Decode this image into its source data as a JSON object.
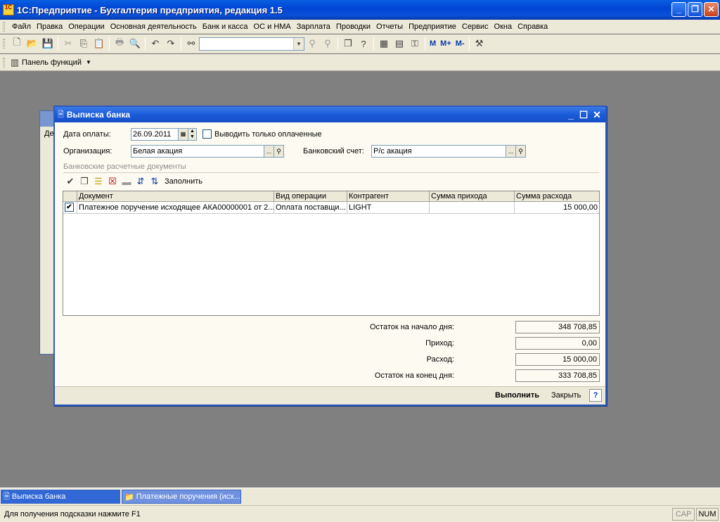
{
  "app": {
    "title": "1С:Предприятие - Бухгалтерия предприятия, редакция 1.5",
    "icon_text": "1C"
  },
  "menu": [
    "Файл",
    "Правка",
    "Операции",
    "Основная деятельность",
    "Банк и касса",
    "ОС и НМА",
    "Зарплата",
    "Проводки",
    "Отчеты",
    "Предприятие",
    "Сервис",
    "Окна",
    "Справка"
  ],
  "toolbar": {
    "m_label": "М",
    "m_plus_label": "М+",
    "m_minus_label": "М-"
  },
  "panel": {
    "label": "Панель функций"
  },
  "dialog": {
    "title": "Выписка банка",
    "date_label": "Дата оплаты:",
    "date_value": "26.09.2011",
    "only_paid_label": "Выводить только оплаченные",
    "only_paid_checked": false,
    "org_label": "Организация:",
    "org_value": "Белая акация",
    "bank_label": "Банковский счет:",
    "bank_value": "Р/с акация",
    "select_btn": "...",
    "search_btn": "🔍",
    "section_title": "Банковские расчетные документы",
    "fill_label": "Заполнить",
    "columns": [
      "Документ",
      "Вид операции",
      "Контрагент",
      "Сумма прихода",
      "Сумма расхода"
    ],
    "rows": [
      {
        "checked": true,
        "document": "Платежное поручение исходящее АКА00000001 от 2...",
        "operation": "Оплата поставщи...",
        "contractor": "LIGHT",
        "income": "",
        "expense": "15 000,00"
      }
    ],
    "totals": {
      "start_label": "Остаток на начало дня:",
      "start_value": "348 708,85",
      "income_label": "Приход:",
      "income_value": "0,00",
      "expense_label": "Расход:",
      "expense_value": "15 000,00",
      "end_label": "Остаток на конец дня:",
      "end_value": "333 708,85"
    },
    "execute_btn": "Выполнить",
    "close_btn": "Закрыть",
    "help_btn": "?"
  },
  "backwin": {
    "tab_text": "Де"
  },
  "taskbar": [
    {
      "label": "Выписка банка",
      "active": true
    },
    {
      "label": "Платежные поручения (исх...",
      "active": false
    }
  ],
  "status": {
    "message": "Для получения подсказки нажмите F1",
    "cap": "CAP",
    "num": "NUM"
  }
}
